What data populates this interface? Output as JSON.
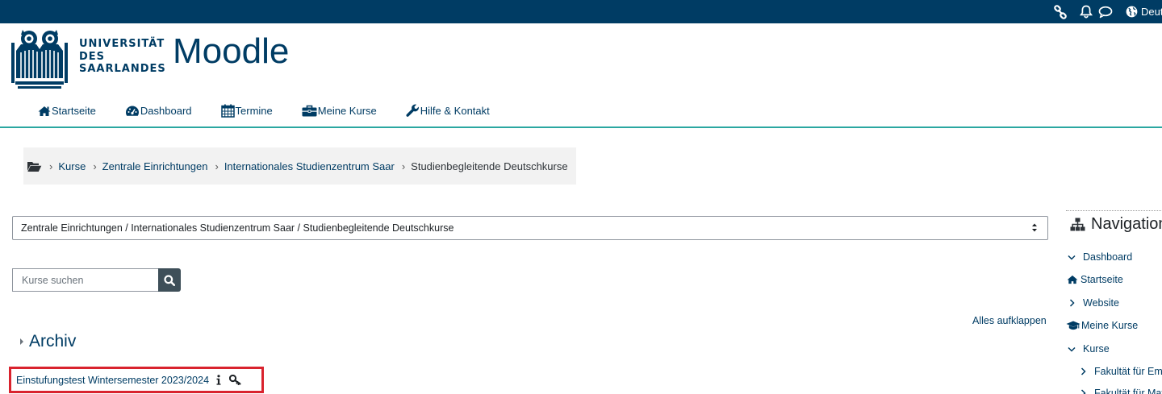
{
  "topbar": {
    "language_label": "Deutsch",
    "icons": [
      "link-icon",
      "bell-icon",
      "chat-icon",
      "globe-icon"
    ],
    "color": "#003c64"
  },
  "brand": {
    "university_line1": "UNIVERSITÄT",
    "university_line2": "DES",
    "university_line3": "SAARLANDES",
    "site_name": "Moodle"
  },
  "main_nav": [
    {
      "label": "Startseite",
      "icon": "home-icon"
    },
    {
      "label": "Dashboard",
      "icon": "dashboard-icon"
    },
    {
      "label": "Termine",
      "icon": "calendar-icon"
    },
    {
      "label": "Meine Kurse",
      "icon": "briefcase-icon"
    },
    {
      "label": "Hilfe & Kontakt",
      "icon": "wrench-icon"
    }
  ],
  "breadcrumb": {
    "items": [
      "Kurse",
      "Zentrale Einrichtungen",
      "Internationales Studienzentrum Saar",
      "Studienbegleitende Deutschkurse"
    ]
  },
  "category_select": {
    "selected": "Zentrale Einrichtungen / Internationales Studienzentrum Saar / Studienbegleitende Deutschkurse"
  },
  "search": {
    "placeholder": "Kurse suchen"
  },
  "expand_all_label": "Alles aufklappen",
  "archive": {
    "title": "Archiv",
    "course_name": "Einstufungstest Wintersemester 2023/2024"
  },
  "navigation_block": {
    "title": "Navigation",
    "items": [
      {
        "label": "Dashboard"
      },
      {
        "label": "Startseite"
      },
      {
        "label": "Website"
      },
      {
        "label": "Meine Kurse"
      },
      {
        "label": "Kurse"
      },
      {
        "label": "Fakultät für Empirische Humanwissenschaften und Wirtschaftswissenschaft"
      },
      {
        "label": "Fakultät für Mathematik und Informatik"
      }
    ]
  },
  "colors": {
    "primary": "#003c64",
    "accent_line": "#2aa7a1",
    "highlight_border": "#d9232e"
  }
}
